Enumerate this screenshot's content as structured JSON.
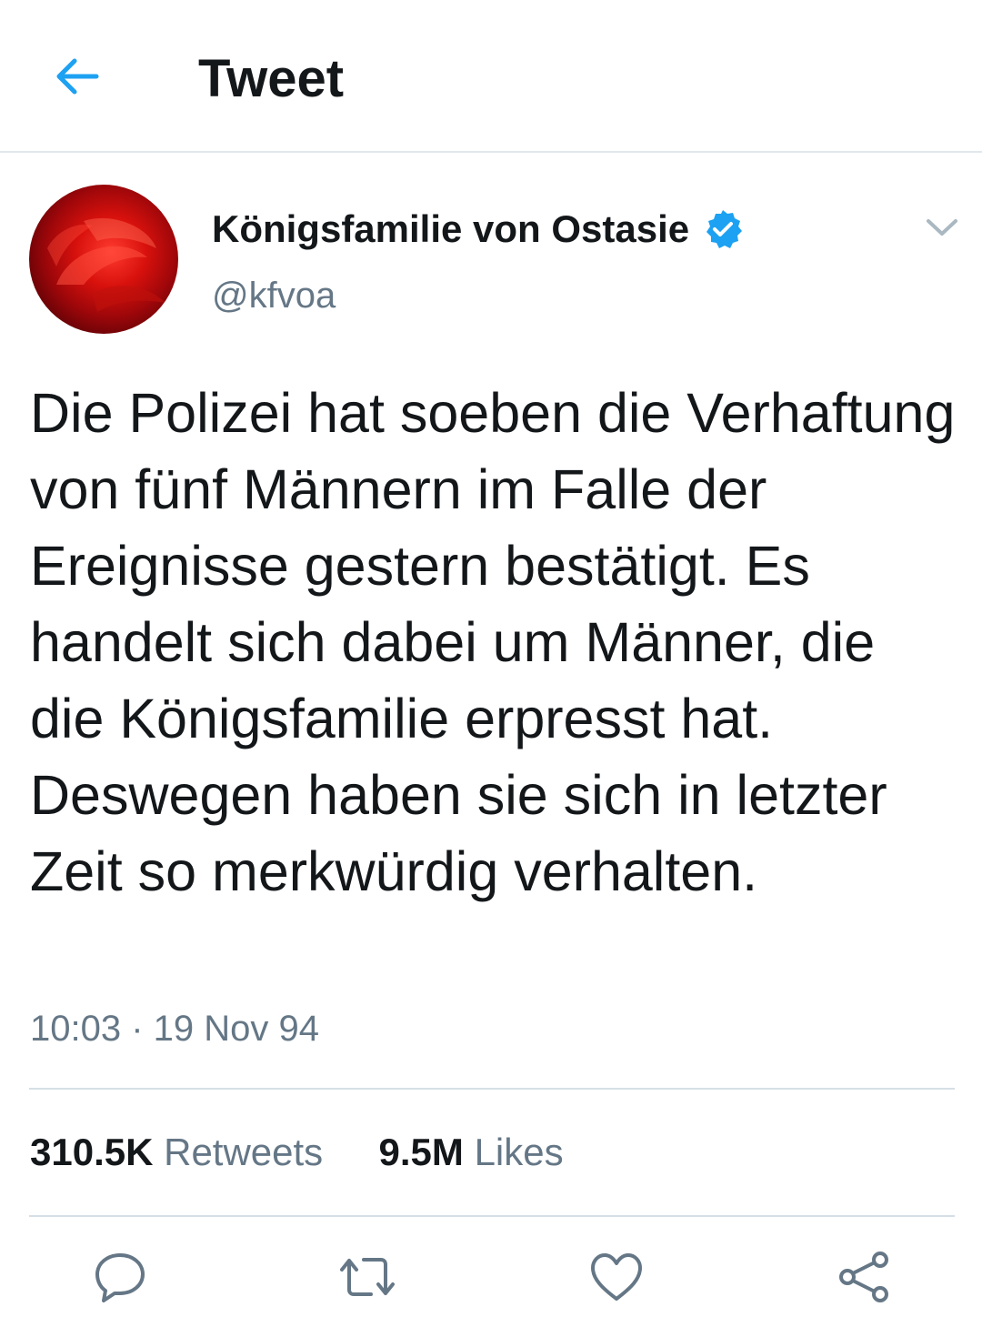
{
  "header": {
    "title": "Tweet",
    "back_icon": "arrow-left-icon"
  },
  "colors": {
    "accent": "#1da1f2",
    "text": "#14171a",
    "secondary_text": "#657786",
    "icon_gray": "#657786"
  },
  "tweet": {
    "display_name": "Königsfamilie von Ostasie",
    "handle": "@kfvoa",
    "verified": true,
    "text": "Die Polizei hat soeben die Verhaftung von fünf Männern im Falle der Ereignisse gestern bestätigt. Es handelt sich dabei um Männer, die die Königsfamilie erpresst hat. Deswegen haben sie sich in letzter Zeit so merkwürdig verhalten.",
    "timestamp": "10:03 · 19 Nov 94"
  },
  "stats": {
    "retweets_count": "310.5K",
    "retweets_label": "Retweets",
    "likes_count": "9.5M",
    "likes_label": "Likes"
  },
  "actions": {
    "reply_icon": "reply-icon",
    "retweet_icon": "retweet-icon",
    "like_icon": "heart-icon",
    "share_icon": "share-icon"
  }
}
